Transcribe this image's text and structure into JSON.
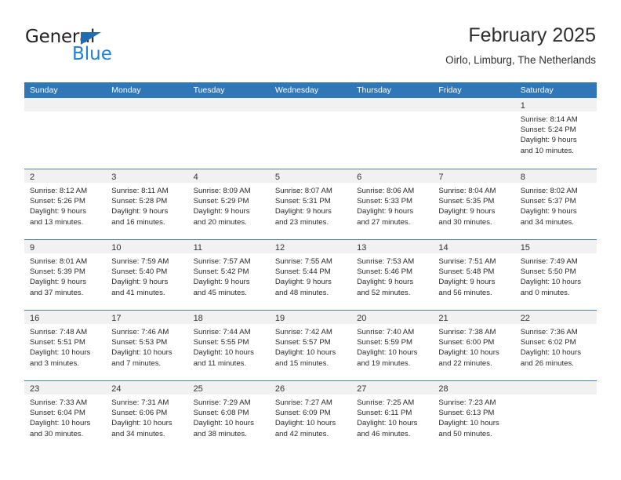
{
  "brand": {
    "name_top": "General",
    "name_bottom": "Blue",
    "triangle_color": "#1f6cb5",
    "blue_text_color": "#1f7fd0"
  },
  "header": {
    "title": "February 2025",
    "subtitle": "Oirlo, Limburg, The Netherlands"
  },
  "theme": {
    "header_bg": "#3077b8",
    "header_text": "#ffffff",
    "row_divider": "#4f80b5",
    "daynum_band": "#f1f1f1",
    "body_text": "#2a2a2a"
  },
  "calendar": {
    "weekday_headers": [
      "Sunday",
      "Monday",
      "Tuesday",
      "Wednesday",
      "Thursday",
      "Friday",
      "Saturday"
    ],
    "weeks": [
      [
        {
          "day": "",
          "sunrise": "",
          "sunset": "",
          "daylight": ""
        },
        {
          "day": "",
          "sunrise": "",
          "sunset": "",
          "daylight": ""
        },
        {
          "day": "",
          "sunrise": "",
          "sunset": "",
          "daylight": ""
        },
        {
          "day": "",
          "sunrise": "",
          "sunset": "",
          "daylight": ""
        },
        {
          "day": "",
          "sunrise": "",
          "sunset": "",
          "daylight": ""
        },
        {
          "day": "",
          "sunrise": "",
          "sunset": "",
          "daylight": ""
        },
        {
          "day": "1",
          "sunrise": "Sunrise: 8:14 AM",
          "sunset": "Sunset: 5:24 PM",
          "daylight": "Daylight: 9 hours and 10 minutes."
        }
      ],
      [
        {
          "day": "2",
          "sunrise": "Sunrise: 8:12 AM",
          "sunset": "Sunset: 5:26 PM",
          "daylight": "Daylight: 9 hours and 13 minutes."
        },
        {
          "day": "3",
          "sunrise": "Sunrise: 8:11 AM",
          "sunset": "Sunset: 5:28 PM",
          "daylight": "Daylight: 9 hours and 16 minutes."
        },
        {
          "day": "4",
          "sunrise": "Sunrise: 8:09 AM",
          "sunset": "Sunset: 5:29 PM",
          "daylight": "Daylight: 9 hours and 20 minutes."
        },
        {
          "day": "5",
          "sunrise": "Sunrise: 8:07 AM",
          "sunset": "Sunset: 5:31 PM",
          "daylight": "Daylight: 9 hours and 23 minutes."
        },
        {
          "day": "6",
          "sunrise": "Sunrise: 8:06 AM",
          "sunset": "Sunset: 5:33 PM",
          "daylight": "Daylight: 9 hours and 27 minutes."
        },
        {
          "day": "7",
          "sunrise": "Sunrise: 8:04 AM",
          "sunset": "Sunset: 5:35 PM",
          "daylight": "Daylight: 9 hours and 30 minutes."
        },
        {
          "day": "8",
          "sunrise": "Sunrise: 8:02 AM",
          "sunset": "Sunset: 5:37 PM",
          "daylight": "Daylight: 9 hours and 34 minutes."
        }
      ],
      [
        {
          "day": "9",
          "sunrise": "Sunrise: 8:01 AM",
          "sunset": "Sunset: 5:39 PM",
          "daylight": "Daylight: 9 hours and 37 minutes."
        },
        {
          "day": "10",
          "sunrise": "Sunrise: 7:59 AM",
          "sunset": "Sunset: 5:40 PM",
          "daylight": "Daylight: 9 hours and 41 minutes."
        },
        {
          "day": "11",
          "sunrise": "Sunrise: 7:57 AM",
          "sunset": "Sunset: 5:42 PM",
          "daylight": "Daylight: 9 hours and 45 minutes."
        },
        {
          "day": "12",
          "sunrise": "Sunrise: 7:55 AM",
          "sunset": "Sunset: 5:44 PM",
          "daylight": "Daylight: 9 hours and 48 minutes."
        },
        {
          "day": "13",
          "sunrise": "Sunrise: 7:53 AM",
          "sunset": "Sunset: 5:46 PM",
          "daylight": "Daylight: 9 hours and 52 minutes."
        },
        {
          "day": "14",
          "sunrise": "Sunrise: 7:51 AM",
          "sunset": "Sunset: 5:48 PM",
          "daylight": "Daylight: 9 hours and 56 minutes."
        },
        {
          "day": "15",
          "sunrise": "Sunrise: 7:49 AM",
          "sunset": "Sunset: 5:50 PM",
          "daylight": "Daylight: 10 hours and 0 minutes."
        }
      ],
      [
        {
          "day": "16",
          "sunrise": "Sunrise: 7:48 AM",
          "sunset": "Sunset: 5:51 PM",
          "daylight": "Daylight: 10 hours and 3 minutes."
        },
        {
          "day": "17",
          "sunrise": "Sunrise: 7:46 AM",
          "sunset": "Sunset: 5:53 PM",
          "daylight": "Daylight: 10 hours and 7 minutes."
        },
        {
          "day": "18",
          "sunrise": "Sunrise: 7:44 AM",
          "sunset": "Sunset: 5:55 PM",
          "daylight": "Daylight: 10 hours and 11 minutes."
        },
        {
          "day": "19",
          "sunrise": "Sunrise: 7:42 AM",
          "sunset": "Sunset: 5:57 PM",
          "daylight": "Daylight: 10 hours and 15 minutes."
        },
        {
          "day": "20",
          "sunrise": "Sunrise: 7:40 AM",
          "sunset": "Sunset: 5:59 PM",
          "daylight": "Daylight: 10 hours and 19 minutes."
        },
        {
          "day": "21",
          "sunrise": "Sunrise: 7:38 AM",
          "sunset": "Sunset: 6:00 PM",
          "daylight": "Daylight: 10 hours and 22 minutes."
        },
        {
          "day": "22",
          "sunrise": "Sunrise: 7:36 AM",
          "sunset": "Sunset: 6:02 PM",
          "daylight": "Daylight: 10 hours and 26 minutes."
        }
      ],
      [
        {
          "day": "23",
          "sunrise": "Sunrise: 7:33 AM",
          "sunset": "Sunset: 6:04 PM",
          "daylight": "Daylight: 10 hours and 30 minutes."
        },
        {
          "day": "24",
          "sunrise": "Sunrise: 7:31 AM",
          "sunset": "Sunset: 6:06 PM",
          "daylight": "Daylight: 10 hours and 34 minutes."
        },
        {
          "day": "25",
          "sunrise": "Sunrise: 7:29 AM",
          "sunset": "Sunset: 6:08 PM",
          "daylight": "Daylight: 10 hours and 38 minutes."
        },
        {
          "day": "26",
          "sunrise": "Sunrise: 7:27 AM",
          "sunset": "Sunset: 6:09 PM",
          "daylight": "Daylight: 10 hours and 42 minutes."
        },
        {
          "day": "27",
          "sunrise": "Sunrise: 7:25 AM",
          "sunset": "Sunset: 6:11 PM",
          "daylight": "Daylight: 10 hours and 46 minutes."
        },
        {
          "day": "28",
          "sunrise": "Sunrise: 7:23 AM",
          "sunset": "Sunset: 6:13 PM",
          "daylight": "Daylight: 10 hours and 50 minutes."
        },
        {
          "day": "",
          "sunrise": "",
          "sunset": "",
          "daylight": ""
        }
      ]
    ]
  }
}
